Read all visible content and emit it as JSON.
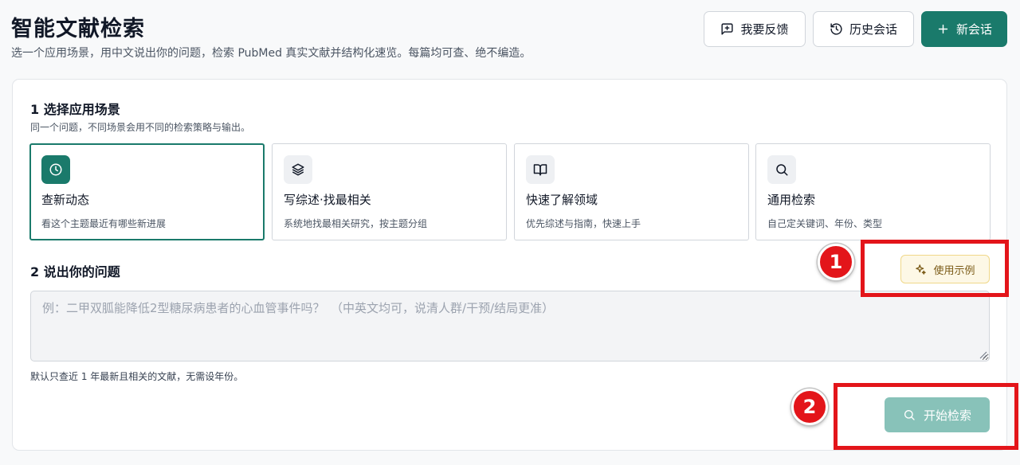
{
  "header": {
    "title": "智能文献检索",
    "subtitle": "选一个应用场景，用中文说出你的问题，检索 PubMed 真实文献并结构化速览。每篇均可查、绝不编造。",
    "buttons": {
      "feedback": "我要反馈",
      "history": "历史会话",
      "new_session": "新会话"
    }
  },
  "section1": {
    "title": "1 选择应用场景",
    "hint": "同一个问题，不同场景会用不同的检索策略与输出。",
    "scenarios": [
      {
        "title": "查新动态",
        "desc": "看这个主题最近有哪些新进展",
        "icon": "clock-icon",
        "selected": true
      },
      {
        "title": "写综述·找最相关",
        "desc": "系统地找最相关研究，按主题分组",
        "icon": "layers-icon",
        "selected": false
      },
      {
        "title": "快速了解领域",
        "desc": "优先综述与指南，快速上手",
        "icon": "book-open-icon",
        "selected": false
      },
      {
        "title": "通用检索",
        "desc": "自己定关键词、年份、类型",
        "icon": "search-icon",
        "selected": false
      }
    ]
  },
  "section2": {
    "title": "2 说出你的问题",
    "example_button": "使用示例",
    "question_value": "",
    "question_placeholder": "例：二甲双胍能降低2型糖尿病患者的心血管事件吗？　（中英文均可，说清人群/干预/结局更准）",
    "note": "默认只查近 1 年最新且相关的文献，无需设年份。",
    "search_button": "开始检索"
  },
  "annotations": [
    {
      "label": "1"
    },
    {
      "label": "2"
    }
  ],
  "colors": {
    "primary": "#1a7a6b",
    "primary_disabled": "#88c2b9",
    "highlight": "#e3151a",
    "example_bg": "#fdf8e6",
    "example_border": "#f0d88a"
  }
}
